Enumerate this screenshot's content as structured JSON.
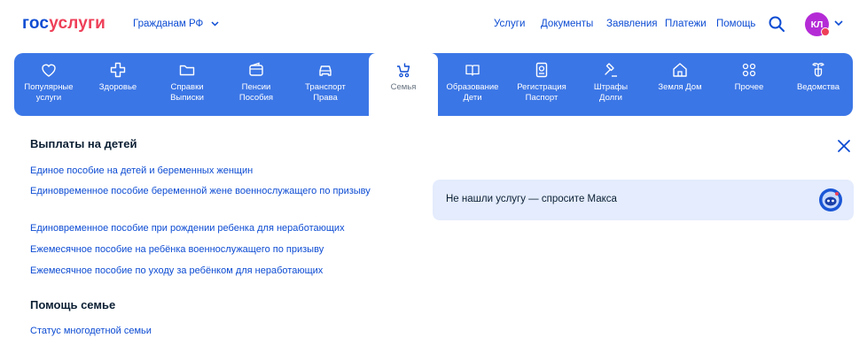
{
  "header": {
    "logo_part1": "гос",
    "logo_part2": "услуги",
    "region": "Гражданам РФ",
    "nav": [
      "Услуги",
      "Документы",
      "Заявления",
      "Платежи",
      "Помощь"
    ],
    "avatar_initials": "КЛ",
    "avatar_color": "#b42bd6"
  },
  "categories": [
    {
      "line1": "Популярные",
      "line2": "услуги",
      "icon": "heart-icon"
    },
    {
      "line1": "Здоровье",
      "line2": "",
      "icon": "medical-cross-icon"
    },
    {
      "line1": "Справки",
      "line2": "Выписки",
      "icon": "folder-icon"
    },
    {
      "line1": "Пенсии",
      "line2": "Пособия",
      "icon": "wallet-icon"
    },
    {
      "line1": "Транспорт",
      "line2": "Права",
      "icon": "car-icon"
    },
    {
      "line1": "Семья",
      "line2": "",
      "icon": "stroller-icon"
    },
    {
      "line1": "Образование",
      "line2": "Дети",
      "icon": "book-icon"
    },
    {
      "line1": "Регистрация",
      "line2": "Паспорт",
      "icon": "passport-icon"
    },
    {
      "line1": "Штрафы",
      "line2": "Долги",
      "icon": "gavel-icon"
    },
    {
      "line1": "Земля Дом",
      "line2": "",
      "icon": "house-icon"
    },
    {
      "line1": "Прочее",
      "line2": "",
      "icon": "grid-icon"
    },
    {
      "line1": "Ведомства",
      "line2": "",
      "icon": "emblem-icon"
    }
  ],
  "active_category": "Семья",
  "sections": [
    {
      "title": "Выплаты на детей",
      "links": [
        "Единое пособие на детей и беременных женщин",
        "Единовременное пособие беременной жене военнослужащего по призыву",
        "Единовременное пособие при рождении ребенка для неработающих",
        "Ежемесячное пособие на ребёнка военнослужащего по призыву",
        "Ежемесячное пособие по уходу за ребёнком для неработающих"
      ]
    },
    {
      "title": "Помощь семье",
      "links": [
        "Статус многодетной семьи"
      ]
    }
  ],
  "assistant": {
    "text": "Не нашли услугу — спросите Макса",
    "icon": "robot-icon"
  },
  "colors": {
    "brand_blue": "#0d4cd3",
    "brand_red": "#ee3f58",
    "category_bar": "#3b76e6",
    "assistant_bg": "#e4ecfd"
  }
}
